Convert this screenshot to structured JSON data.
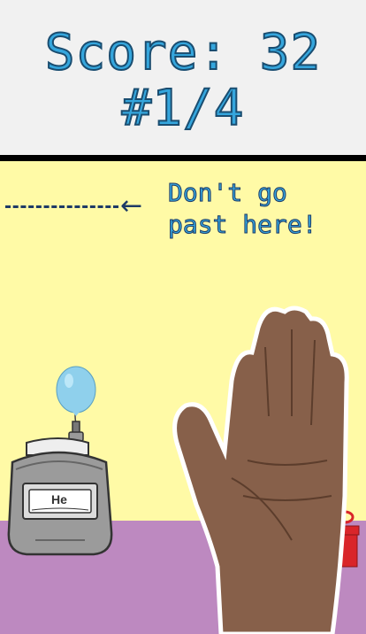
{
  "hud": {
    "score_label": "Score: 32",
    "level_label": "#1/4"
  },
  "goal_line": {
    "message": "Don't go past here!",
    "arrow_glyph": "←"
  },
  "tank": {
    "label": "He"
  },
  "colors": {
    "hud_text": "#35a6dd",
    "hud_outline": "#1a4d70",
    "wall": "#fffaa6",
    "floor": "#bd89c0",
    "balloon": "#8fd0ec"
  }
}
